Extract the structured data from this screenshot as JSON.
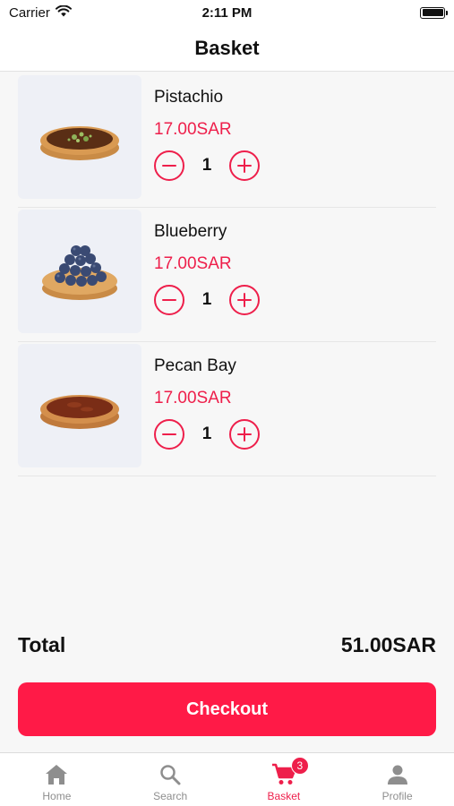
{
  "status_bar": {
    "carrier": "Carrier",
    "time": "2:11 PM"
  },
  "nav": {
    "title": "Basket"
  },
  "items": [
    {
      "name": "Pistachio",
      "price": "17.00SAR",
      "quantity": "1",
      "image": "pistachio-tart"
    },
    {
      "name": "Blueberry",
      "price": "17.00SAR",
      "quantity": "1",
      "image": "blueberry-tart"
    },
    {
      "name": "Pecan Bay",
      "price": "17.00SAR",
      "quantity": "1",
      "image": "pecan-tart"
    }
  ],
  "summary": {
    "total_label": "Total",
    "total_value": "51.00SAR"
  },
  "checkout": {
    "label": "Checkout"
  },
  "tabs": [
    {
      "label": "Home",
      "icon": "home-icon"
    },
    {
      "label": "Search",
      "icon": "search-icon"
    },
    {
      "label": "Basket",
      "icon": "cart-icon",
      "badge": "3",
      "active": true
    },
    {
      "label": "Profile",
      "icon": "person-icon"
    }
  ],
  "colors": {
    "accent": "#ee1f4b",
    "button": "#ff1a47",
    "inactive": "#8e8e8e"
  }
}
